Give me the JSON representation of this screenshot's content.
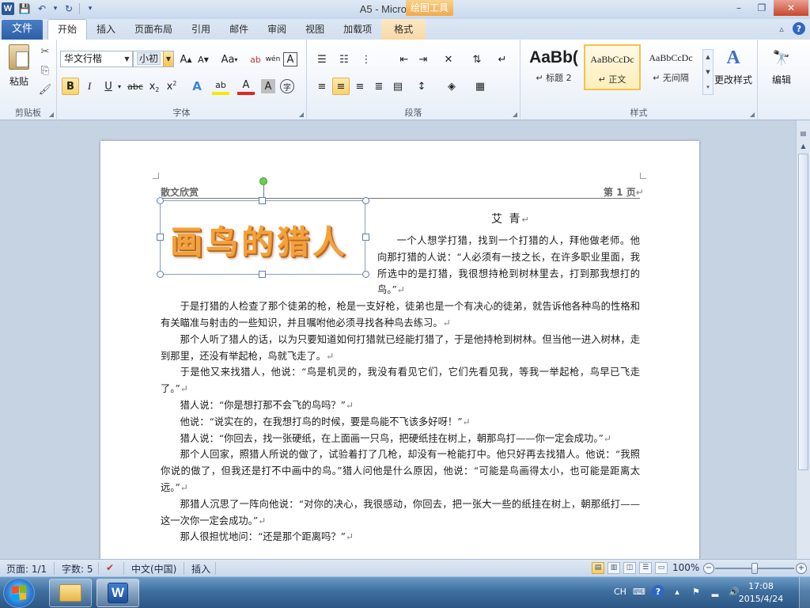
{
  "window": {
    "title": "A5 - Microsoft Word",
    "app_letter": "W",
    "context_tools": "绘图工具",
    "minimize": "–",
    "restore": "❐",
    "close": "✕"
  },
  "qat": {
    "save": "💾",
    "undo": "↶",
    "undo_dd": "▾",
    "redo": "↻",
    "customize": "▾"
  },
  "tabs": {
    "file": "文件",
    "items": [
      "开始",
      "插入",
      "页面布局",
      "引用",
      "邮件",
      "审阅",
      "视图",
      "加载项",
      "格式"
    ],
    "collapse": "▵",
    "help": "?"
  },
  "ribbon": {
    "clipboard": {
      "label": "剪贴板",
      "paste": "粘贴",
      "cut": "✂",
      "copy": "⎘",
      "painter": "🖌"
    },
    "font": {
      "label": "字体",
      "family": "华文行楷",
      "size": "小初",
      "grow": "A",
      "shrink": "A",
      "change_case": "Aa",
      "clear": "ab",
      "phonetic": "wén",
      "border": "A",
      "bold": "B",
      "italic": "I",
      "underline": "U",
      "strike": "abc",
      "subscript": "x",
      "superscript": "x",
      "effects": "A",
      "highlight": "ab",
      "color": "A",
      "shading": "A",
      "enclose": "字"
    },
    "paragraph": {
      "label": "段落"
    },
    "styles": {
      "label": "样式",
      "items": [
        {
          "preview": "AaBb(",
          "name": "↵ 标题 2"
        },
        {
          "preview": "AaBbCcDc",
          "name": "↵ 正文"
        },
        {
          "preview": "AaBbCcDc",
          "name": "↵ 无间隔"
        }
      ],
      "change": "更改样式",
      "change_icon": "A"
    },
    "editing": {
      "label": "编辑",
      "icon": "🔭"
    }
  },
  "document": {
    "header_left": "散文欣赏",
    "header_right": "第 1 页",
    "return_mark": "↵",
    "wordart": "画鸟的猎人",
    "author": "艾 青",
    "paragraphs": [
      "一个人想学打猎，找到一个打猎的人，拜他做老师。他向那打猎的人说：“人必须有一技之长，在许多职业里面，我所选中的是打猎，我很想持枪到树林里去，打到那我想打的鸟。”",
      "于是打猎的人检查了那个徒弟的枪，枪是一支好枪，徒弟也是一个有决心的徒弟，就告诉他各种鸟的性格和有关瞄准与射击的一些知识，并且嘱咐他必须寻找各种鸟去练习。",
      "那个人听了猎人的话，以为只要知道如何打猎就已经能打猎了，于是他持枪到树林。但当他一进入树林，走到那里，还没有举起枪，鸟就飞走了。",
      "于是他又来找猎人，他说：“鸟是机灵的，我没有看见它们，它们先看见我，等我一举起枪，鸟早已飞走了。”",
      "猎人说：“你是想打那不会飞的鸟吗？”",
      "他说：“说实在的，在我想打鸟的时候，要是鸟能不飞该多好呀！”",
      "猎人说：“你回去，找一张硬纸，在上面画一只鸟，把硬纸挂在树上，朝那鸟打——你一定会成功。”",
      "那个人回家，照猎人所说的做了，试验着打了几枪，却没有一枪能打中。他只好再去找猎人。他说：“我照你说的做了，但我还是打不中画中的鸟。”猎人问他是什么原因，他说：“可能是鸟画得太小，也可能是距离太远。”",
      "那猎人沉思了一阵向他说：“对你的决心，我很感动，你回去，把一张大一些的纸挂在树上，朝那纸打——这一次你一定会成功。”",
      "那人很担忧地问：“还是那个距离吗？”"
    ]
  },
  "statusbar": {
    "page": "页面: 1/1",
    "words": "字数: 5",
    "language": "中文(中国)",
    "mode": "插入",
    "zoom": "100%",
    "zoom_out": "−",
    "zoom_in": "+",
    "zoom_level_percent": 100
  },
  "taskbar": {
    "ime": "CH",
    "help": "?",
    "time": "17:08",
    "date": "2015/4/24"
  }
}
